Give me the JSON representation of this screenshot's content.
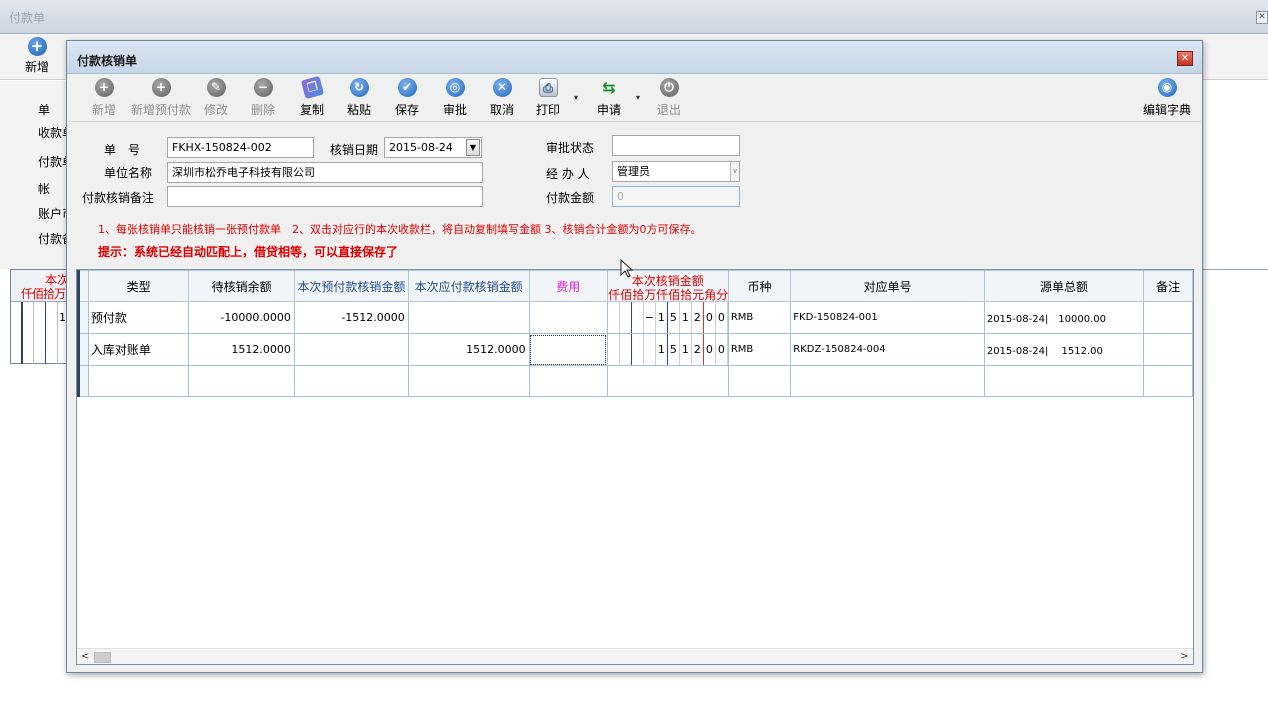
{
  "background_window": {
    "title": "付款单",
    "close_glyph": "✕",
    "add_label": "新增",
    "form_labels": [
      "单",
      "收款单",
      "付款单",
      "帐",
      "账户币",
      "付款备"
    ],
    "grid_head_title": "本次",
    "grid_head_units": "仟佰拾万",
    "row1_value": "1"
  },
  "dialog": {
    "title": "付款核销单",
    "close_glyph": "✕"
  },
  "toolbar": {
    "add": "新增",
    "add_prepay": "新增预付款",
    "edit": "修改",
    "delete": "删除",
    "copy": "复制",
    "paste": "粘贴",
    "save": "保存",
    "approve": "审批",
    "cancel": "取消",
    "print": "打印",
    "apply": "申请",
    "exit": "退出",
    "edit_dictionary": "编辑字典",
    "caret": "▾"
  },
  "form": {
    "doc_no_label": "单　号",
    "doc_no": "FKHX-150824-002",
    "date_label": "核销日期",
    "date": "2015-08-24",
    "approval_status_label": "审批状态",
    "approval_status": "",
    "unit_name_label": "单位名称",
    "unit_name": "深圳市松乔电子科技有限公司",
    "handler_label": "经 办 人",
    "handler": "管理员",
    "remark_label": "付款核销备注",
    "remark": "",
    "amount_label": "付款金额",
    "amount": "0",
    "dropdown_glyph": "▼",
    "combo_glyph": "∨"
  },
  "notes": {
    "rules": "1、每张核销单只能核销一张预付款单　2、双击对应行的本次收款栏，将自动复制填写金额 3、核销合计金额为0方可保存。",
    "hint": "提示：系统已经自动匹配上，借贷相等，可以直接保存了"
  },
  "grid": {
    "columns": {
      "type": "类型",
      "pending_balance": "待核销余额",
      "prepay_amount": "本次预付款核销金额",
      "payable_amount": "本次应付款核销金额",
      "fee": "费用",
      "writeoff_title": "本次核销金额",
      "currency": "币种",
      "ref_no": "对应单号",
      "source_total": "源单总额",
      "remark": "备注"
    },
    "digit_units": [
      "仟",
      "佰",
      "拾",
      "万",
      "仟",
      "佰",
      "拾",
      "元",
      "角",
      "分"
    ],
    "rows": [
      {
        "type": "预付款",
        "pending_balance": "-10000.0000",
        "prepay_amount": "-1512.0000",
        "payable_amount": "",
        "fee": "",
        "digits": [
          "",
          "",
          "",
          "−",
          "1",
          "5",
          "1",
          "2",
          "0",
          "0"
        ],
        "currency": "RMB",
        "ref_no": "FKD-150824-001",
        "source_total": "2015-08-24|　10000.00",
        "remark": ""
      },
      {
        "type": "入库对账单",
        "pending_balance": "1512.0000",
        "prepay_amount": "",
        "payable_amount": "1512.0000",
        "fee": "",
        "digits": [
          "",
          "",
          "",
          "",
          "1",
          "5",
          "1",
          "2",
          "0",
          "0"
        ],
        "currency": "RMB",
        "ref_no": "RKDZ-150824-004",
        "source_total": "2015-08-24|　 1512.00",
        "remark": ""
      }
    ]
  },
  "scroll": {
    "left": "<",
    "right": ">"
  },
  "colors": {
    "accent_red": "#e00000",
    "header_blue": "#1f4c8c",
    "fee_pink": "#e020e0",
    "grid_line": "#9fc0de"
  }
}
